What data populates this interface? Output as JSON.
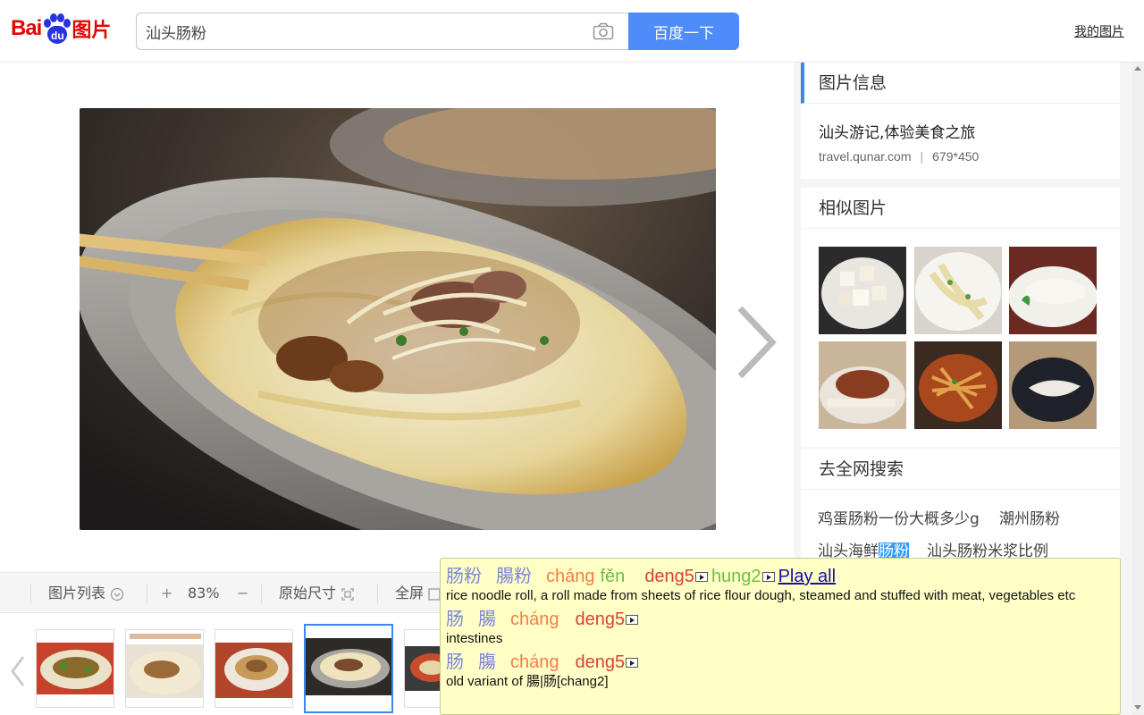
{
  "header": {
    "logo_bai": "Bai",
    "logo_du": "du",
    "logo_tupian": "图片",
    "search_value": "汕头肠粉",
    "search_button": "百度一下",
    "my_pictures": "我的图片"
  },
  "toolbar": {
    "image_list": "图片列表",
    "zoom_in": "+",
    "zoom_level": "83%",
    "zoom_out": "−",
    "original_size": "原始尺寸",
    "fullscreen": "全屏"
  },
  "info_card": {
    "title": "图片信息",
    "source_title": "汕头游记,体验美食之旅",
    "domain": "travel.qunar.com",
    "separator": "|",
    "dimensions": "679*450"
  },
  "similar_card": {
    "title": "相似图片"
  },
  "web_search_card": {
    "title": "去全网搜索",
    "suggestions": [
      "鸡蛋肠粉一份大概多少g",
      "潮州肠粉",
      "汕头海鲜",
      "肠粉",
      "汕头肠粉米浆比例"
    ]
  },
  "popup": {
    "entry1": {
      "simplified": "肠粉",
      "traditional": "腸粉",
      "pinyin1": "cháng",
      "pinyin2": "fěn",
      "jyutping1": "deng5",
      "jyutping2": "hung2",
      "play_all": "Play all",
      "definition": "rice noodle roll, a roll made from sheets of rice flour dough, steamed and stuffed with meat, vegetables etc"
    },
    "entry2": {
      "simplified": "肠",
      "traditional": "腸",
      "pinyin": "cháng",
      "jyutping": "deng5",
      "definition": "intestines"
    },
    "entry3": {
      "simplified": "肠",
      "traditional": "膓",
      "pinyin": "cháng",
      "jyutping": "deng5",
      "definition": "old variant of 腸|肠[chang2]"
    }
  },
  "colors": {
    "accent_blue": "#4e8cf9",
    "baidu_red": "#e10601",
    "baidu_blue": "#2932e1",
    "popup_bg": "#ffffc6"
  }
}
